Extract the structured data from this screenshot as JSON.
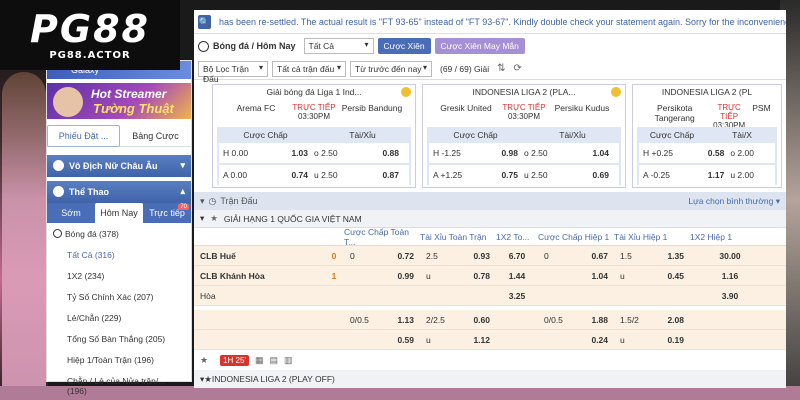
{
  "logo": {
    "main": "PG88",
    "sub": "PG88.ACTOR"
  },
  "sidebar": {
    "banner_top": "Galaxy",
    "banner_hot_line1": "Hot Streamer",
    "banner_hot_line2": "Tường Thuật",
    "tabs": [
      "Phiếu Đặt ...",
      "Bảng Cược"
    ],
    "section1": "Vô Địch Nữ Châu Âu",
    "section2": "Thể Thao",
    "sport_tabs": [
      "Sớm",
      "Hôm Nay",
      "Trực tiếp"
    ],
    "live_badge": "70",
    "items": [
      "Bóng đá (378)",
      "Tất Cả (316)",
      "1X2 (234)",
      "Tỷ Số Chính Xác (207)",
      "Lẻ/Chẵn (229)",
      "Tổng Số Bàn Thắng (205)",
      "Hiệp 1/Toàn Trận (196)",
      "Chẵn / Lẻ của Nửa trận/... (196)"
    ]
  },
  "notice": "has been re-settled. The actual result is \"FT 93-65\" instead of \"FT 93-67\". Kindly double check your statement again. Sorry for the inconvenience caused!",
  "toolbar": {
    "crumb": "Bóng đá / Hôm Nay",
    "select_all": "Tất Cả",
    "btn_parlay": "Cược Xiên",
    "btn_lucky": "Cược Xiên May Mắn"
  },
  "filters": {
    "league": "Bộ Lọc Trận Đấu",
    "matches": "Tất cả trận đấu",
    "sort": "Từ trước đến nay",
    "count": "(69 / 69) Giải"
  },
  "cards": [
    {
      "title": "Giải bóng đá Liga 1 Ind...",
      "home": "Arema FC",
      "away": "Persib Bandung",
      "live": "TRỰC TIẾP",
      "time": "03:30PM",
      "hdr_ah": "Cược Chấp",
      "hdr_ou": "Tài/Xỉu",
      "rows": [
        {
          "ah_l": "H 0.00",
          "ah_v": "1.03",
          "ou_l": "o 2.50",
          "ou_v": "0.88"
        },
        {
          "ah_l": "A 0.00",
          "ah_v": "0.74",
          "ou_l": "u 2.50",
          "ou_v": "0.87"
        }
      ]
    },
    {
      "title": "INDONESIA LIGA 2 (PLA...",
      "home": "Gresik United",
      "away": "Persiku Kudus",
      "live": "TRỰC TIẾP",
      "time": "03:30PM",
      "hdr_ah": "Cược Chấp",
      "hdr_ou": "Tài/Xỉu",
      "rows": [
        {
          "ah_l": "H -1.25",
          "ah_v": "0.98",
          "ou_l": "o 2.50",
          "ou_v": "1.04"
        },
        {
          "ah_l": "A +1.25",
          "ah_v": "0.75",
          "ou_l": "u 2.50",
          "ou_v": "0.69"
        }
      ]
    },
    {
      "title": "INDONESIA LIGA 2 (PL",
      "home": "Persikota Tangerang",
      "away": "PSM",
      "live": "TRỰC TIẾP",
      "time": "03:30PM",
      "hdr_ah": "Cược Chấp",
      "hdr_ou": "Tài/X",
      "rows": [
        {
          "ah_l": "H +0.25",
          "ah_v": "0.58",
          "ou_l": "o 2.00",
          "ou_v": ""
        },
        {
          "ah_l": "A -0.25",
          "ah_v": "1.17",
          "ou_l": "u 2.00",
          "ou_v": ""
        }
      ]
    }
  ],
  "section_title": "Trận Đấu",
  "sort_label": "Lựa chọn bình thường",
  "league1": "GIẢI HẠNG 1 QUỐC GIA VIỆT NAM",
  "headers": [
    "Cược Chấp Toàn T...",
    "Tài Xỉu Toàn Trận",
    "1X2 To...",
    "Cược Chấp Hiệp 1",
    "Tài Xỉu Hiệp 1",
    "1X2 Hiệp 1"
  ],
  "match": {
    "home": "CLB Huế",
    "away": "CLB Khánh Hòa",
    "draw": "Hòa",
    "home_score": "0",
    "away_score": "1",
    "row1": {
      "ah_l": "0",
      "ah_v": "0.72",
      "ou_l": "2.5",
      "ou_v": "0.93",
      "x12": "6.70",
      "ah1_l": "0",
      "ah1_v": "0.67",
      "ou1_l": "1.5",
      "ou1_v": "1.35",
      "x121": "30.00"
    },
    "row2": {
      "ah_l": "",
      "ah_v": "0.99",
      "ou_l": "u",
      "ou_v": "0.78",
      "x12": "1.44",
      "ah1_l": "",
      "ah1_v": "1.04",
      "ou1_l": "u",
      "ou1_v": "0.45",
      "x121": "1.16"
    },
    "row3": {
      "x12": "3.25",
      "x121": "3.90"
    },
    "row4": {
      "ah_l": "0/0.5",
      "ah_v": "1.13",
      "ou_l": "2/2.5",
      "ou_v": "0.60",
      "ah1_l": "0/0.5",
      "ah1_v": "1.88",
      "ou1_l": "1.5/2",
      "ou1_v": "2.08"
    },
    "row5": {
      "ah_v": "0.59",
      "ou_l": "u",
      "ou_v": "1.12",
      "ah1_v": "0.24",
      "ou1_l": "u",
      "ou1_v": "0.19"
    },
    "live_time": "1H 25'"
  },
  "league2": "INDONESIA LIGA 2 (PLAY OFF)"
}
